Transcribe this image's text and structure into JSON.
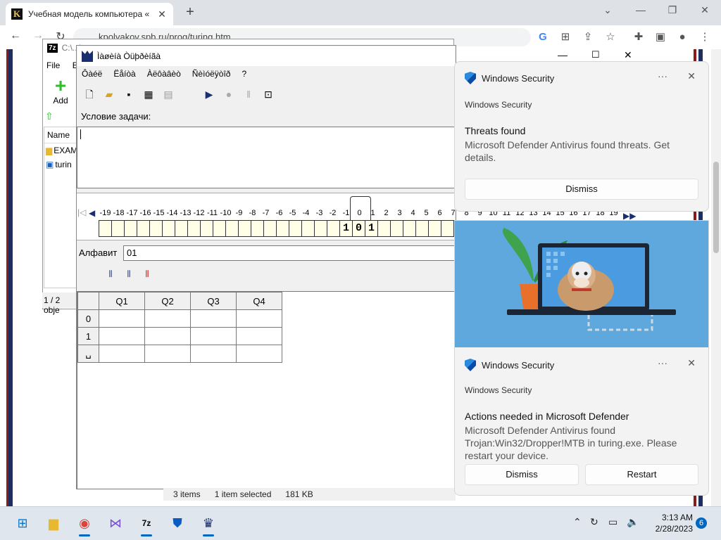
{
  "browser": {
    "tab_title": "Учебная модель компьютера «",
    "tab_close": "✕",
    "new_tab": "+",
    "url": "kpolyakov.spb.ru/prog/turing.htm",
    "favicon_letter": "K",
    "window_controls": [
      "⌄",
      "—",
      "❐",
      "✕"
    ]
  },
  "zip_window": {
    "title": "C:\\...\\...",
    "logo": "7z",
    "menu": [
      "File",
      "Ed"
    ],
    "add_label": "Add",
    "columns": [
      "Name"
    ],
    "items": [
      "EXAM",
      "turin"
    ],
    "status": "1 / 2 obje"
  },
  "turing": {
    "title": "Ìàøèíà Òüþðèíãà",
    "menu": [
      "Ôàéë",
      "Ëåíòà",
      "Àëôàâèò",
      "Ñèìóëÿòîð",
      "?"
    ],
    "condition_label": "Условие задачи:",
    "tape_numbers": [
      "-19",
      "-18",
      "-17",
      "-16",
      "-15",
      "-14",
      "-13",
      "-12",
      "-11",
      "-10",
      "-9",
      "-8",
      "-7",
      "-6",
      "-5",
      "-4",
      "-3",
      "-2",
      "-1",
      "0",
      "1",
      "2",
      "3",
      "4",
      "5",
      "6",
      "7",
      "8",
      "9",
      "10",
      "11",
      "12",
      "13",
      "14",
      "15",
      "16",
      "17",
      "18",
      "19"
    ],
    "tape_values": [
      "",
      "",
      "",
      "",
      "",
      "",
      "",
      "",
      "",
      "",
      "",
      "",
      "",
      "",
      "",
      "",
      "",
      "",
      "",
      "1",
      "0",
      "1",
      "",
      "",
      "",
      "",
      "",
      "",
      "",
      "",
      "",
      "",
      "",
      "",
      "",
      "",
      "",
      "",
      ""
    ],
    "alphabet_label": "Алфавит",
    "alphabet_value": "01",
    "state_headers": [
      "Q1",
      "Q2",
      "Q3",
      "Q4"
    ],
    "state_rows": [
      "0",
      "1",
      "␣"
    ]
  },
  "explorer_status": {
    "items": "3 items",
    "selected": "1 item selected",
    "size": "181 KB"
  },
  "notification1": {
    "app": "Windows Security",
    "source": "Windows Security",
    "title": "Threats found",
    "body": "Microsoft Defender Antivirus found threats. Get details.",
    "dismiss": "Dismiss",
    "more": "···",
    "close": "✕"
  },
  "notification2": {
    "app": "Windows Security",
    "source": "Windows Security",
    "title": "Actions needed in Microsoft Defender",
    "body": "Microsoft Defender Antivirus found Trojan:Win32/Dropper!MTB in turing.exe. Please restart your device.",
    "dismiss": "Dismiss",
    "restart": "Restart",
    "more": "···",
    "close": "✕"
  },
  "taskbar": {
    "time": "3:13 AM",
    "date": "2/28/2023",
    "notification_count": "6"
  },
  "colors": {
    "accent": "#0067c0",
    "tape_bg": "#ffffe8",
    "turing_blue": "#1a2f70"
  }
}
